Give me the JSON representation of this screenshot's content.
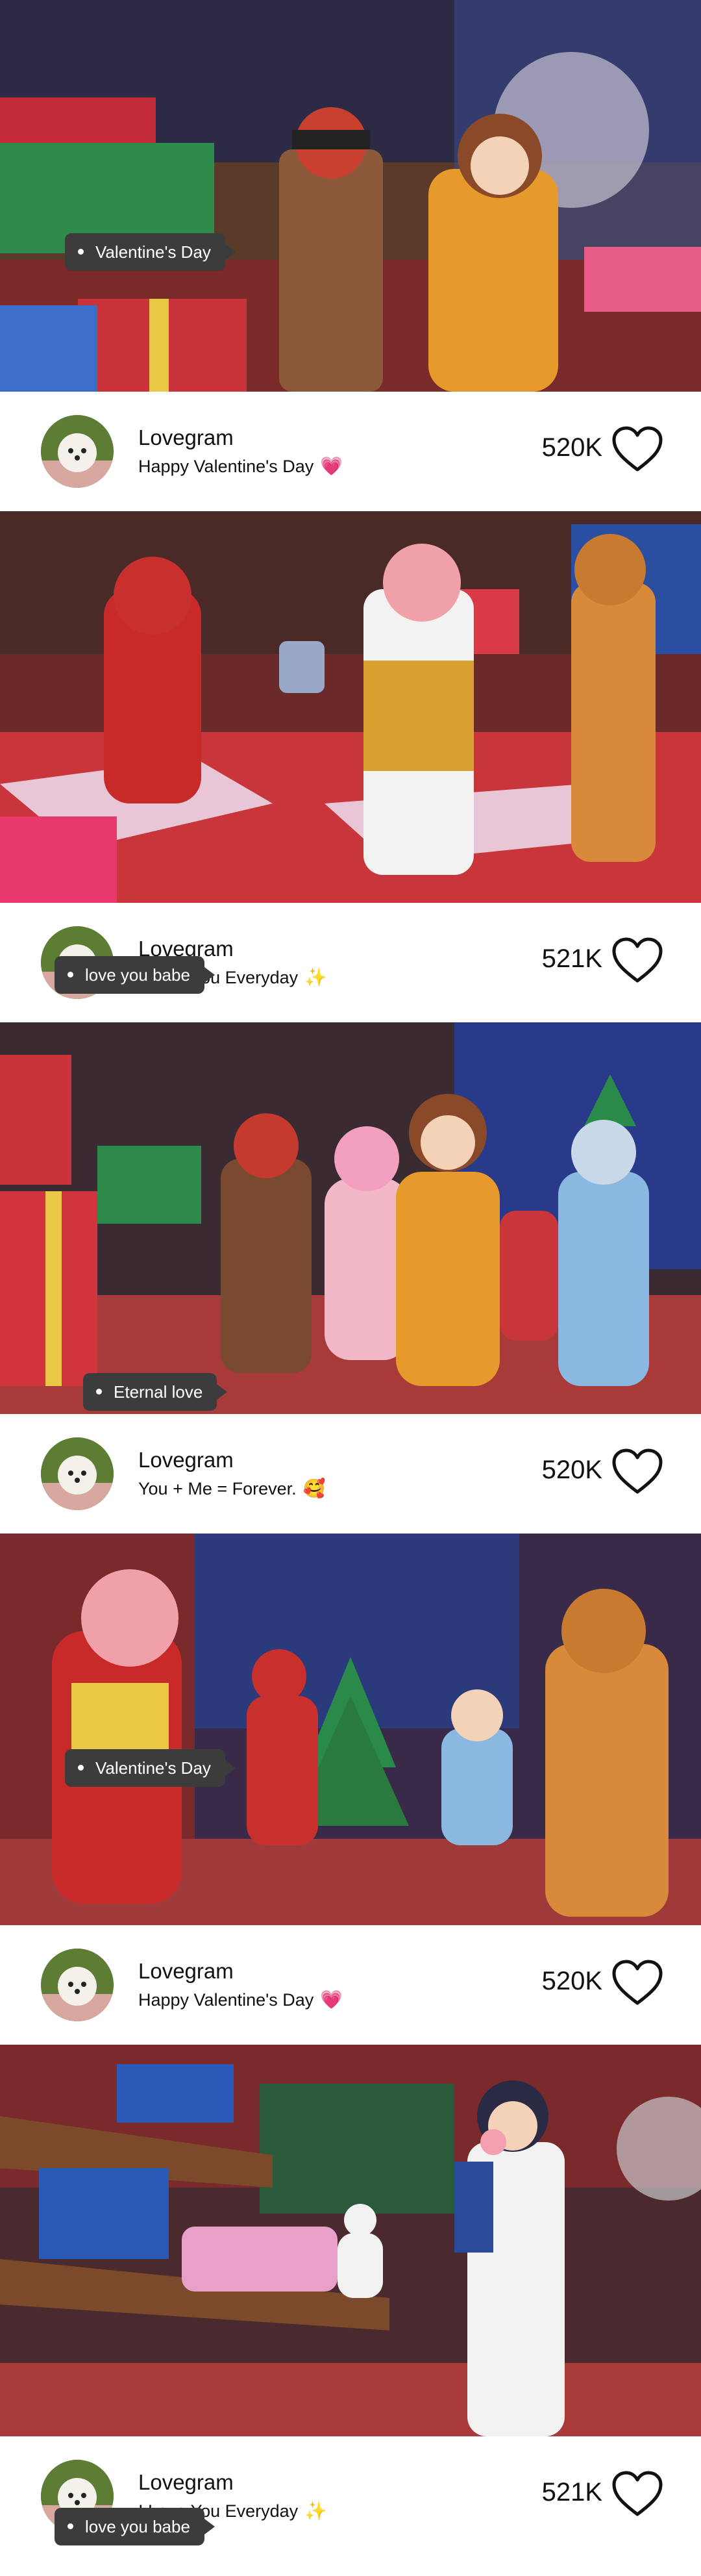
{
  "posts": [
    {
      "username": "Lovegram",
      "caption": "Happy Valentine's Day",
      "caption_emoji": "💗",
      "likes": "520K",
      "tag": "Valentine's Day",
      "scene": "couple-presents"
    },
    {
      "username": "Lovegram",
      "caption": "I Love You Everyday",
      "caption_emoji": "✨",
      "likes": "521K",
      "tag": "love you babe",
      "scene": "reindeer-trio"
    },
    {
      "username": "Lovegram",
      "caption": "You + Me = Forever.",
      "caption_emoji": "🥰",
      "likes": "520K",
      "tag": "Eternal love",
      "scene": "group-shop"
    },
    {
      "username": "Lovegram",
      "caption": "Happy Valentine's Day",
      "caption_emoji": "💗",
      "likes": "520K",
      "tag": "Valentine's Day",
      "scene": "cheer-xmas-tree"
    },
    {
      "username": "Lovegram",
      "caption": "I Love You Everyday",
      "caption_emoji": "✨",
      "likes": "521K",
      "tag": "love you babe",
      "scene": "shelves-cake"
    }
  ],
  "colors": {
    "tag_bg": "#3c3c3c",
    "heart_stroke": "#111111",
    "text": "#111111"
  },
  "icons": {
    "like": "heart-outline-icon",
    "avatar": "puppy-avatar"
  }
}
